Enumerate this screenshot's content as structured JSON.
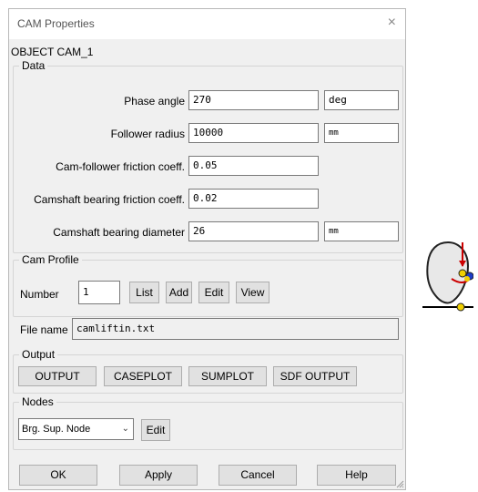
{
  "window": {
    "title": "CAM Properties",
    "close_glyph": "×"
  },
  "object_label": "OBJECT  CAM_1",
  "data_group": {
    "legend": "Data",
    "phase_angle_label": "Phase angle",
    "phase_angle_value": "270",
    "phase_angle_unit": "deg",
    "follower_radius_label": "Follower radius",
    "follower_radius_value": "10000",
    "follower_radius_unit": "mm",
    "friction_coeff_label": "Cam-follower friction coeff.",
    "friction_coeff_value": "0.05",
    "bearing_friction_label": "Camshaft bearing friction coeff.",
    "bearing_friction_value": "0.02",
    "bearing_diameter_label": "Camshaft bearing diameter",
    "bearing_diameter_value": "26",
    "bearing_diameter_unit": "mm"
  },
  "cam_profile": {
    "legend": "Cam Profile",
    "number_label": "Number",
    "number_value": "1",
    "list_label": "List",
    "add_label": "Add",
    "edit_label": "Edit",
    "view_label": "View",
    "file_name_label": "File name",
    "file_name_value": "camliftin.txt"
  },
  "output": {
    "legend": "Output",
    "output_label": "OUTPUT",
    "caseplot_label": "CASEPLOT",
    "sumplot_label": "SUMPLOT",
    "sdf_output_label": "SDF OUTPUT"
  },
  "nodes": {
    "legend": "Nodes",
    "selected_node": "Brg. Sup. Node",
    "edit_label": "Edit"
  },
  "footer": {
    "ok_label": "OK",
    "apply_label": "Apply",
    "cancel_label": "Cancel",
    "help_label": "Help"
  },
  "icons": {
    "close": "close-icon",
    "dropdown": "chevron-down-icon",
    "resize": "resize-grip-icon",
    "cam_diagram": "cam-follower-diagram-icon"
  },
  "colors": {
    "dialog_bg": "#f0f0f0",
    "button_bg": "#e1e1e1",
    "diagram_red": "#cc0000",
    "diagram_yellow": "#f0d000",
    "diagram_blue": "#1e3cc8"
  }
}
